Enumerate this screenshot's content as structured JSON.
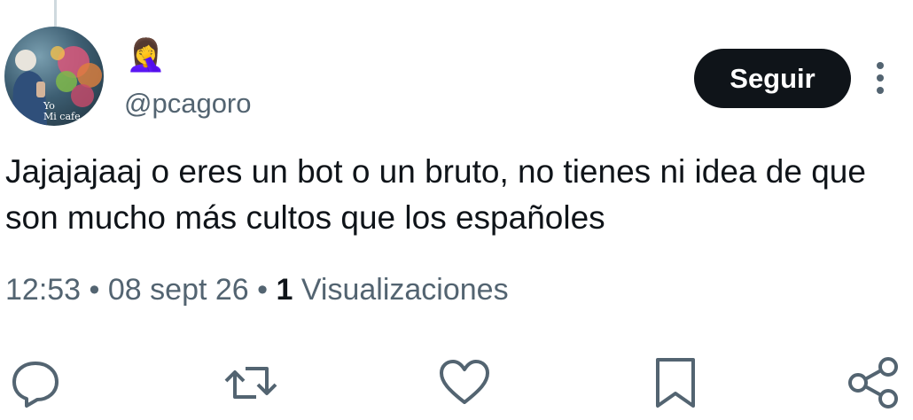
{
  "author": {
    "display_name_emoji": "🤦‍♀️",
    "handle": "@pcagoro",
    "avatar_caption_line1": "Yo",
    "avatar_caption_line2": "Mi cafe"
  },
  "header": {
    "follow_label": "Seguir"
  },
  "tweet": {
    "text": "Jajajajaaj o eres un bot o un bruto, no tienes ni idea de que son mucho más cultos que los españoles"
  },
  "meta": {
    "time": "12:53",
    "separator": " • ",
    "date": "08 sept 26",
    "views_count": "1",
    "views_label": "Visualizaciones"
  },
  "actions": {
    "icons": [
      "reply-icon",
      "retweet-icon",
      "like-icon",
      "bookmark-icon",
      "share-icon"
    ]
  },
  "colors": {
    "text": "#0f1419",
    "muted": "#536471",
    "button_bg": "#0f1419",
    "icon": "#536471"
  }
}
